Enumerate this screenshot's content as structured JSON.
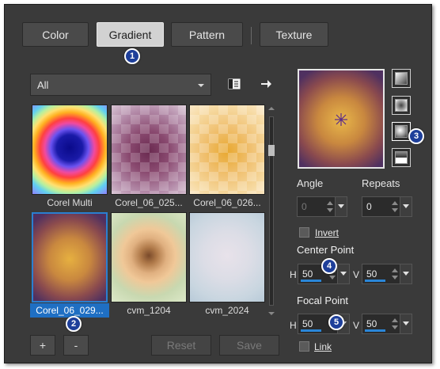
{
  "tabs": [
    {
      "label": "Color",
      "active": false
    },
    {
      "label": "Gradient",
      "active": true
    },
    {
      "label": "Pattern",
      "active": false
    },
    {
      "label": "Texture",
      "active": false
    }
  ],
  "badges": [
    "1",
    "2",
    "3",
    "4",
    "5"
  ],
  "category_dropdown": {
    "value": "All"
  },
  "toolbar_icons": [
    "library-icon",
    "arrow-right-icon"
  ],
  "gradients": [
    {
      "caption": "Corel Multi",
      "selected": false
    },
    {
      "caption": "Corel_06_025...",
      "selected": false
    },
    {
      "caption": "Corel_06_026...",
      "selected": false
    },
    {
      "caption": "Corel_06_029...",
      "selected": true
    },
    {
      "caption": "cvm_1204",
      "selected": false
    },
    {
      "caption": "cvm_2024",
      "selected": false
    }
  ],
  "buttons": {
    "add": "+",
    "remove": "-",
    "reset": "Reset",
    "save": "Save"
  },
  "style_buttons": [
    "linear-style-icon",
    "rectangular-style-icon",
    "sunburst-style-icon",
    "radial-style-icon"
  ],
  "angle": {
    "label": "Angle",
    "value": "0"
  },
  "repeats": {
    "label": "Repeats",
    "value": "0"
  },
  "invert": {
    "label": "Invert",
    "checked": false
  },
  "center_point": {
    "label": "Center Point",
    "h_label": "H",
    "h_value": "50",
    "v_label": "V",
    "v_value": "50"
  },
  "focal_point": {
    "label": "Focal Point",
    "h_label": "H",
    "h_value": "50",
    "v_label": "V",
    "v_value": "50"
  },
  "link": {
    "label": "Link",
    "checked": false
  },
  "colors": {
    "panel": "#3a3a3a",
    "accent": "#1f6fc3",
    "badge": "#1e3f9a"
  }
}
